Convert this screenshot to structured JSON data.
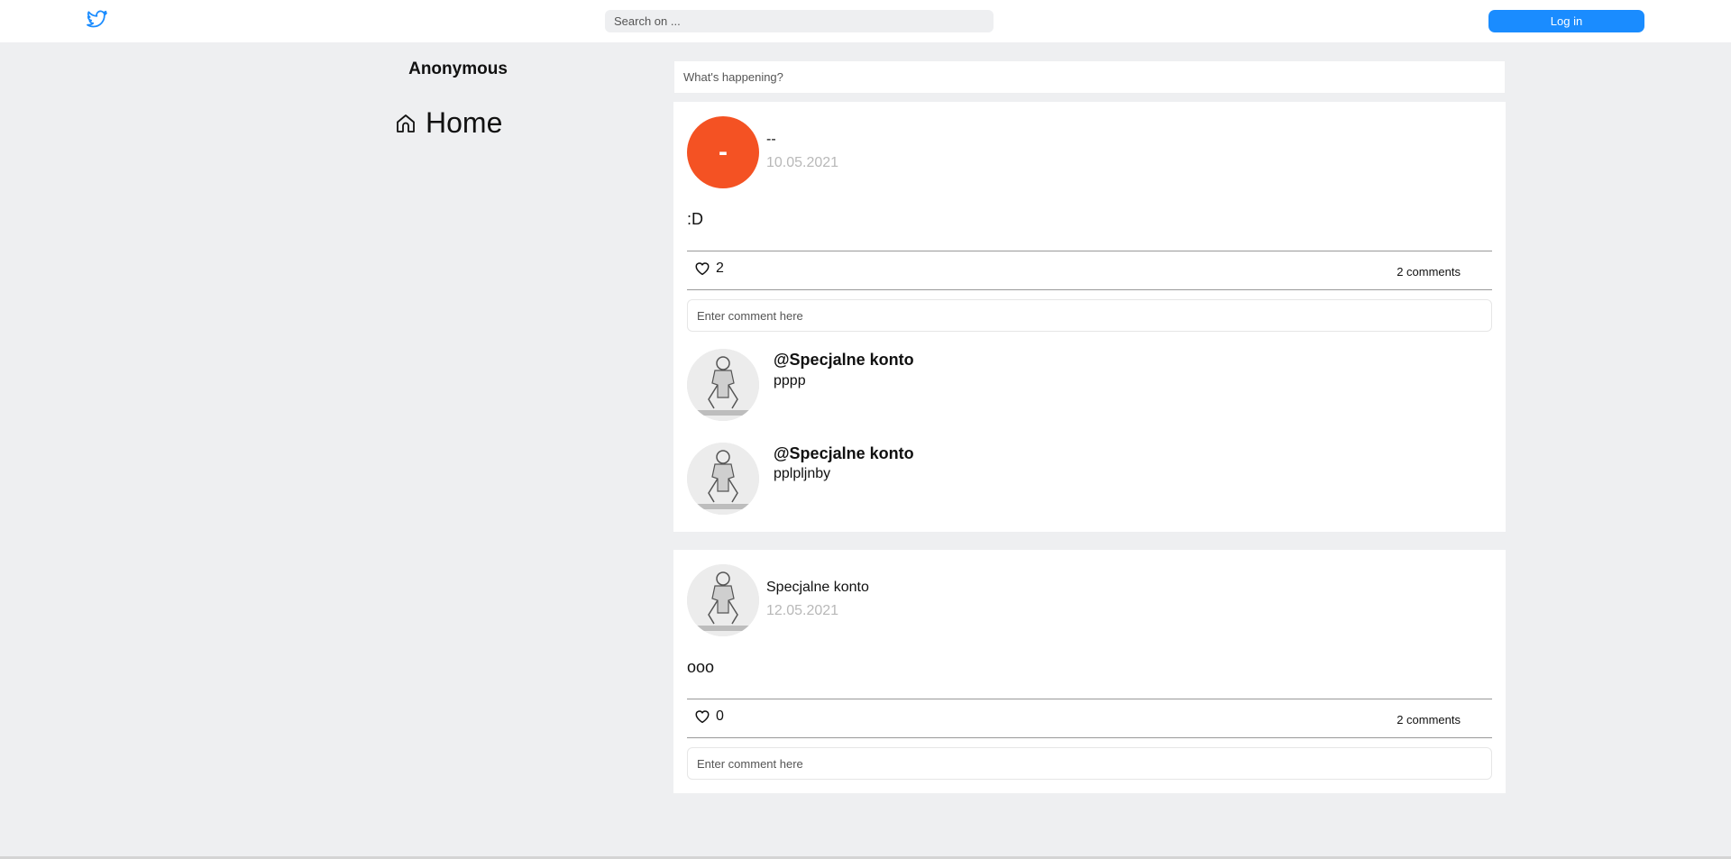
{
  "header": {
    "logo_icon": "twitter-bird-icon",
    "search_placeholder": "Search on ...",
    "login_label": "Log in",
    "accent": "#1a8cff"
  },
  "sidebar": {
    "username": "Anonymous",
    "nav": [
      {
        "icon": "home-icon",
        "label": "Home"
      }
    ]
  },
  "compose": {
    "placeholder": "What's happening?"
  },
  "posts": [
    {
      "avatar_letter": "-",
      "avatar_color": "#f45223",
      "author": "--",
      "date": "10.05.2021",
      "body": ":D",
      "likes": "2",
      "comments_label": "2 comments",
      "comment_placeholder": "Enter comment here",
      "comments": [
        {
          "author": "@Specjalne konto",
          "text": "pppp"
        },
        {
          "author": "@Specjalne konto",
          "text": "pplpljnby"
        }
      ]
    },
    {
      "author": "Specjalne konto",
      "date": "12.05.2021",
      "body": "ooo",
      "likes": "0",
      "comments_label": "2 comments",
      "comment_placeholder": "Enter comment here"
    }
  ]
}
